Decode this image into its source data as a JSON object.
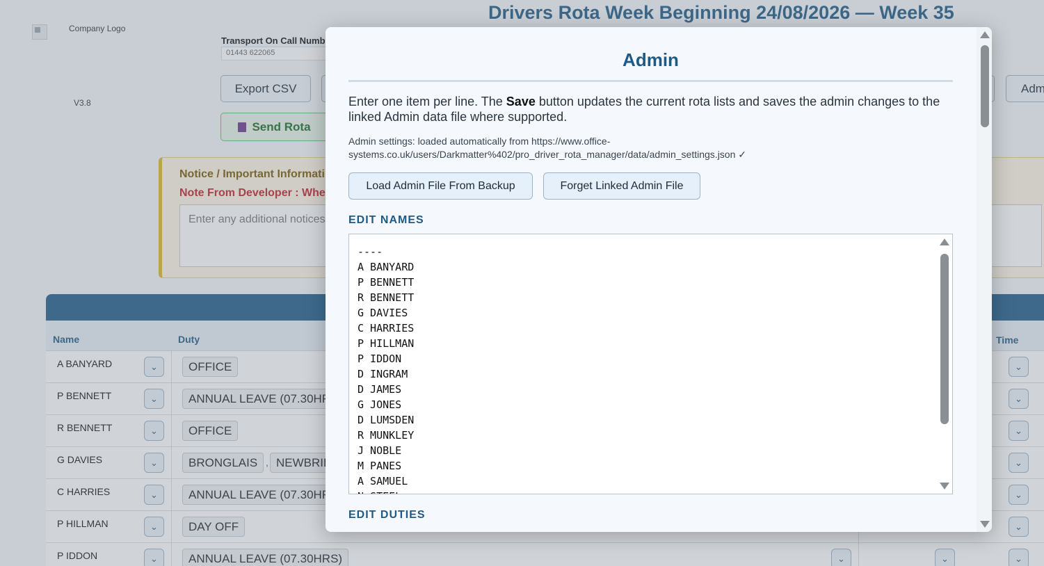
{
  "page": {
    "title": "Drivers Rota Week Beginning 24/08/2026 — Week 35",
    "logo_alt": "Company Logo",
    "version": "V3.8"
  },
  "oncall": {
    "label": "Transport On Call Numb",
    "value": "01443 622065"
  },
  "toolbar": {
    "export_label": "Export CSV",
    "admin_label": "Adm",
    "send_label": "Send Rota"
  },
  "notice": {
    "heading": "Notice / Important Informati",
    "developer_note": "Note From Developer : Whe",
    "placeholder": "Enter any additional notices"
  },
  "table": {
    "headers": {
      "name": "Name",
      "duty": "Duty",
      "time": "Time"
    },
    "rows": [
      {
        "name": "A BANYARD",
        "duty": "OFFICE"
      },
      {
        "name": "P BENNETT",
        "duty": "ANNUAL LEAVE (07.30HR"
      },
      {
        "name": "R BENNETT",
        "duty": "OFFICE"
      },
      {
        "name": "G DAVIES",
        "duty": "BRONGLAIS",
        "duty2": "NEWBRID",
        "separator": ","
      },
      {
        "name": "C HARRIES",
        "duty": "ANNUAL LEAVE (07.30HR"
      },
      {
        "name": "P HILLMAN",
        "duty": "DAY OFF"
      },
      {
        "name": "P IDDON",
        "duty": "ANNUAL LEAVE (07.30HRS)"
      }
    ]
  },
  "modal": {
    "title": "Admin",
    "desc_pre": "Enter one item per line. The ",
    "desc_bold": "Save",
    "desc_post": " button updates the current rota lists and saves the admin changes to the linked Admin data file where supported.",
    "status": "Admin settings: loaded automatically from https://www.office-systems.co.uk/users/Darkmatter%402/pro_driver_rota_manager/data/admin_settings.json ✓",
    "load_button": "Load Admin File From Backup",
    "forget_button": "Forget Linked Admin File",
    "edit_names_heading": "EDIT NAMES",
    "names": [
      "----",
      "A BANYARD",
      "P BENNETT",
      "R BENNETT",
      "G DAVIES",
      "C HARRIES",
      "P HILLMAN",
      "P IDDON",
      "D INGRAM",
      "D JAMES",
      "G JONES",
      "D LUMSDEN",
      "R MUNKLEY",
      "J NOBLE",
      "M PANES",
      "A SAMUEL",
      "N STEEL"
    ],
    "edit_duties_heading": "EDIT DUTIES"
  }
}
